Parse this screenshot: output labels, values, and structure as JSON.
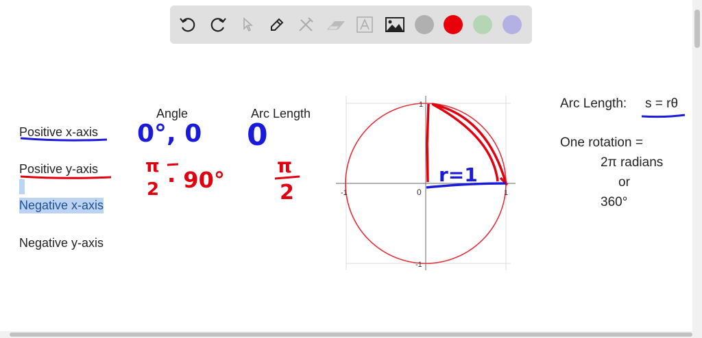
{
  "toolbar": {
    "tools": [
      "undo-icon",
      "redo-icon",
      "select-icon",
      "pen-icon",
      "tools-icon",
      "eraser-icon",
      "text-icon",
      "image-icon"
    ],
    "colors": [
      "#b0b0b0",
      "#e8000b",
      "#b5d6b5",
      "#b3b0e3"
    ]
  },
  "left_labels": [
    "Positive x-axis",
    "Positive y-axis",
    "Negative x-axis",
    "Negative y-axis"
  ],
  "headers": {
    "angle": "Angle",
    "arc_length": "Arc Length"
  },
  "handwritten": {
    "angle_row1": "0°, 0",
    "arc_row1": "0",
    "angle_row2_num": "π",
    "angle_row2_den": "2",
    "angle_row2_deg": "· 90°",
    "arc_row2_num": "π",
    "arc_row2_den": "2",
    "radius_label": "r=1"
  },
  "graph": {
    "ticks": {
      "x_neg": "-1",
      "origin": "0",
      "x_pos": "1",
      "y_pos": "1",
      "y_neg": "-1"
    }
  },
  "right_notes": {
    "formula_label": "Arc Length:",
    "formula": "s = rθ",
    "rotation": "One rotation =",
    "radians": "2π radians",
    "or": "or",
    "degrees": "360°"
  }
}
